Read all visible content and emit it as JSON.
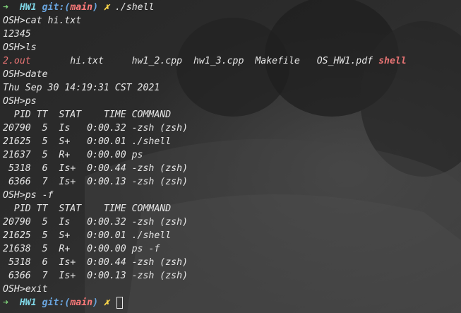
{
  "prompt1": {
    "arrow": "➜",
    "dir": "HW1",
    "git_prefix": "git:(",
    "branch": "main",
    "git_suffix": ")",
    "dirty": "✗",
    "command": "./shell"
  },
  "lines": {
    "l2": "OSH>cat hi.txt",
    "l3": "12345",
    "l4": "OSH>ls",
    "l6": "OSH>date",
    "l7": "Thu Sep 30 14:19:31 CST 2021",
    "l8": "OSH>ps",
    "l9": "  PID TT  STAT    TIME COMMAND",
    "l10": "20790  5  Is   0:00.32 -zsh (zsh)",
    "l11": "21625  5  S+   0:00.01 ./shell",
    "l12": "21637  5  R+   0:00.00 ps",
    "l13": " 5318  6  Is+  0:00.44 -zsh (zsh)",
    "l14": " 6366  7  Is+  0:00.13 -zsh (zsh)",
    "l15": "OSH>ps -f",
    "l16": "  PID TT  STAT    TIME COMMAND",
    "l17": "20790  5  Is   0:00.32 -zsh (zsh)",
    "l18": "21625  5  S+   0:00.01 ./shell",
    "l19": "21638  5  R+   0:00.00 ps -f",
    "l20": " 5318  6  Is+  0:00.44 -zsh (zsh)",
    "l21": " 6366  7  Is+  0:00.13 -zsh (zsh)",
    "l22": "OSH>exit"
  },
  "ls_output": {
    "f1": "2.out",
    "f2": "hi.txt",
    "f3": "hw1_2.cpp",
    "f4": "hw1_3.cpp",
    "f5": "Makefile",
    "f6": "OS_HW1.pdf",
    "f7": "shell"
  },
  "prompt2": {
    "arrow": "➜",
    "dir": "HW1",
    "git_prefix": "git:(",
    "branch": "main",
    "git_suffix": ")",
    "dirty": "✗"
  },
  "colors": {
    "background": "#2a2a2a",
    "text": "#e6e6e6",
    "arrow": "#7fd37a",
    "dir": "#7fd6e6",
    "git": "#6aa6e0",
    "branch": "#ff7a7a",
    "dirty": "#ffd84a",
    "executable": "#e87474"
  }
}
